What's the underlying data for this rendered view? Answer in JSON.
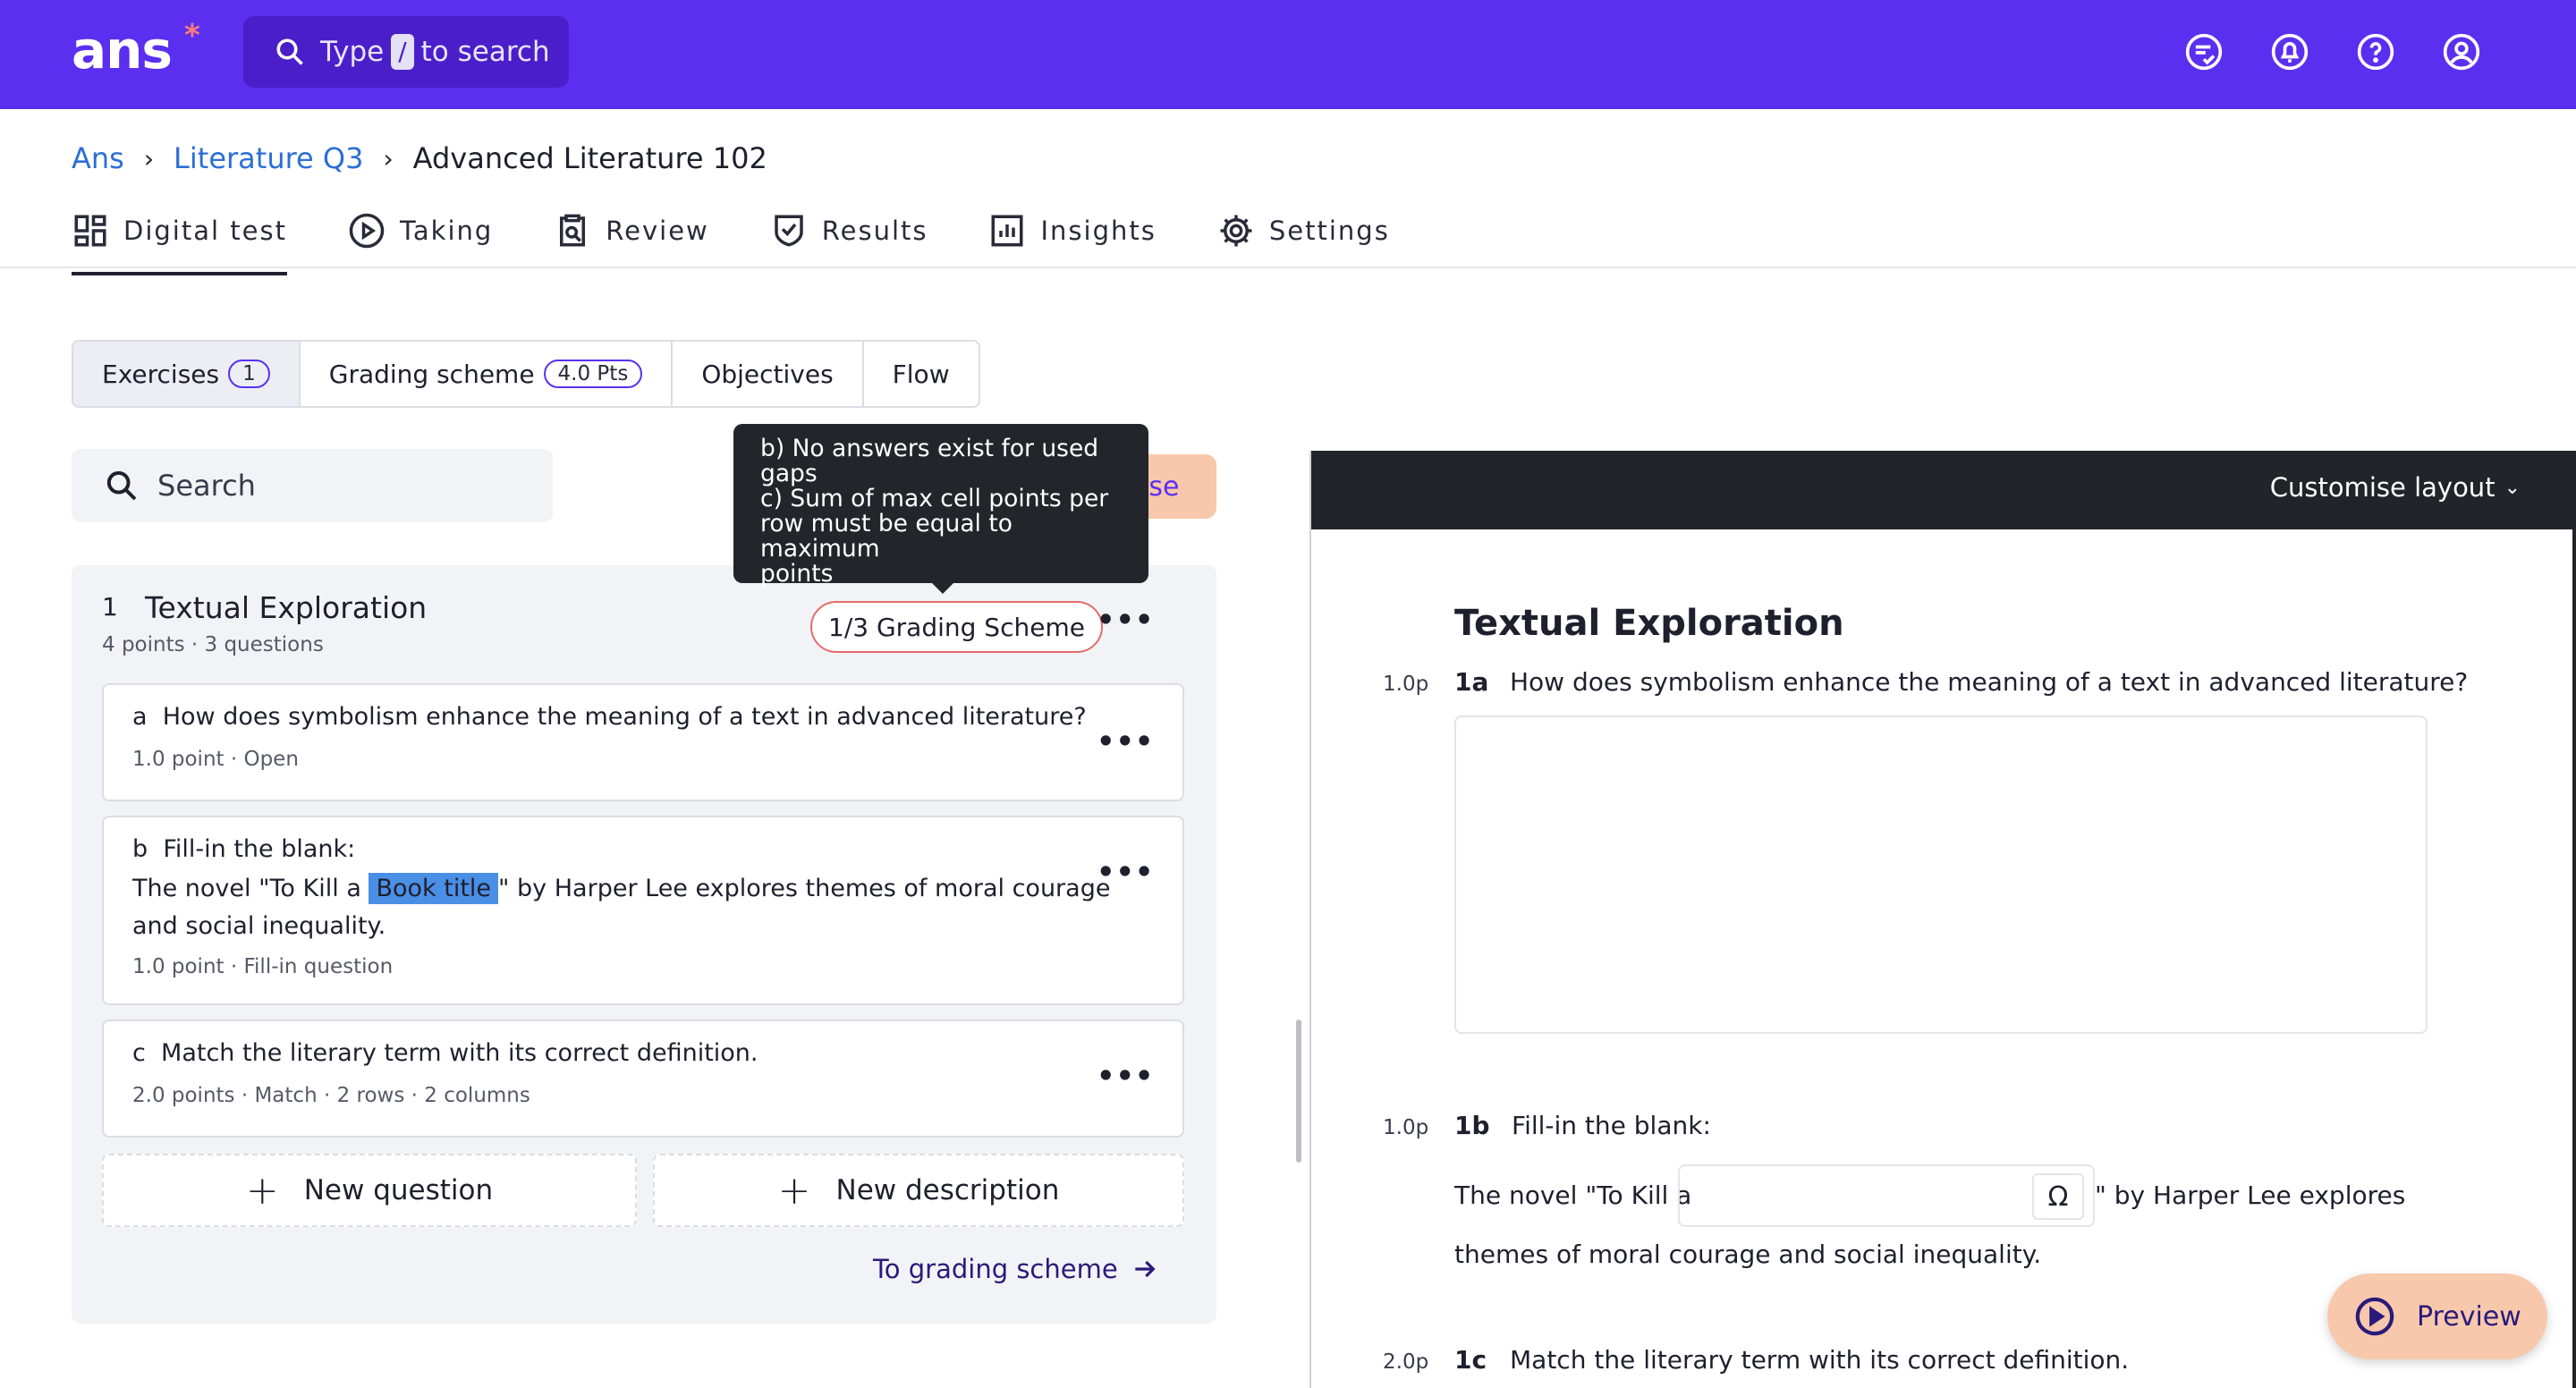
{
  "app": {
    "logo": "ans",
    "logo_mark": "*"
  },
  "search": {
    "prefix": "Type",
    "key": "/",
    "suffix": "to search"
  },
  "top_icons": [
    "feedback-icon",
    "notifications-icon",
    "help-icon",
    "account-icon"
  ],
  "breadcrumb": {
    "root": "Ans",
    "parent": "Literature Q3",
    "current": "Advanced Literature 102"
  },
  "main_tabs": [
    {
      "label": "Digital test",
      "icon": "dashboard-icon",
      "active": true
    },
    {
      "label": "Taking",
      "icon": "play-circle-icon"
    },
    {
      "label": "Review",
      "icon": "clipboard-search-icon"
    },
    {
      "label": "Results",
      "icon": "shield-check-icon"
    },
    {
      "label": "Insights",
      "icon": "bar-chart-icon"
    },
    {
      "label": "Settings",
      "icon": "gear-icon"
    }
  ],
  "sub_tabs": [
    {
      "label": "Exercises",
      "badge": "1",
      "active": true
    },
    {
      "label": "Grading scheme",
      "badge": "4.0 Pts"
    },
    {
      "label": "Objectives"
    },
    {
      "label": "Flow"
    }
  ],
  "left_search": {
    "placeholder": "Search"
  },
  "partial_button": {
    "label": "ise"
  },
  "tooltip": {
    "line1": "b) No answers exist for used",
    "line2": "gaps",
    "line3": "c) Sum of max cell points per",
    "line4": "row must be equal to maximum",
    "line5": "points"
  },
  "exercise": {
    "number": "1",
    "title": "Textual Exploration",
    "meta": "4 points · 3 questions",
    "grading_status": "1/3 Grading Scheme",
    "questions": [
      {
        "letter": "a",
        "text": "How does symbolism enhance the meaning of a text in advanced literature?",
        "meta": "1.0 point · Open"
      },
      {
        "letter": "b",
        "text": "Fill-in the blank:",
        "sentence_before": "The novel \"To Kill a",
        "gap": "Book title",
        "sentence_after": "\" by Harper Lee explores themes of moral courage",
        "sentence_line2": "and social inequality.",
        "meta": "1.0 point · Fill-in question"
      },
      {
        "letter": "c",
        "text": "Match the literary term with its correct definition.",
        "meta": "2.0 points · Match · 2 rows · 2 columns"
      }
    ],
    "new_question": "New question",
    "new_description": "New description",
    "to_grading": "To grading scheme"
  },
  "preview": {
    "customise": "Customise layout",
    "title": "Textual Exploration",
    "q1": {
      "points": "1.0p",
      "num": "1a",
      "text": "How does symbolism enhance the meaning of a text in advanced literature?"
    },
    "q2": {
      "points": "1.0p",
      "num": "1b",
      "text": "Fill-in the blank:",
      "before": "The novel \"To Kill a",
      "after": "\" by Harper Lee explores",
      "line2": "themes of moral courage and social inequality.",
      "special_char": "Ω"
    },
    "q3": {
      "points": "2.0p",
      "num": "1c",
      "text": "Match the literary term with its correct definition."
    },
    "preview_button": "Preview"
  }
}
